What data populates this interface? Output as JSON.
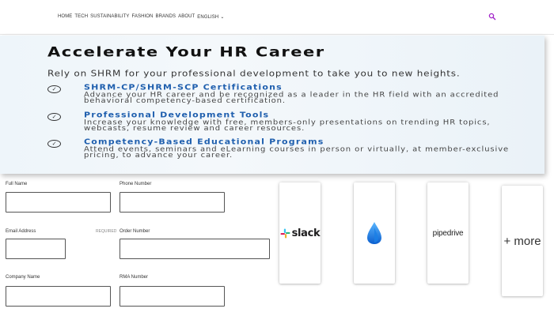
{
  "nav": {
    "items": [
      "HOME",
      "TECH",
      "SUSTAINABILITY",
      "FASHION",
      "BRANDS",
      "ABOUT",
      "ENGLISH"
    ],
    "language_caret": "⌄",
    "search_icon": "search-icon",
    "accent_color": "#a020c8"
  },
  "banner": {
    "title": "Accelerate Your HR Career",
    "intro": "Rely on SHRM for your professional development to take you to new heights.",
    "features": [
      {
        "title": "SHRM-CP/SHRM-SCP Certifications",
        "description": "Advance your HR career and be recognized as a leader in the HR field with an accredited behavioral competency-based certification."
      },
      {
        "title": "Professional Development Tools",
        "description": "Increase your knowledge with free, members-only presentations on trending HR topics, webcasts, resume review and career resources."
      },
      {
        "title": "Competency-Based Educational Programs",
        "description": "Attend events, seminars and eLearning courses in person or virtually, at member-exclusive pricing, to advance your career."
      }
    ],
    "title_color": "#111111",
    "feature_color": "#1f5fae"
  },
  "form": {
    "full_name_label": "Full Name",
    "phone_label": "Phone Number",
    "email_label": "Email Address",
    "email_required": "REQUIRED",
    "order_label": "Order Number",
    "company_label": "Company Name",
    "rma_label": "RMA Number"
  },
  "integrations": {
    "slack": "slack",
    "pipedrive": "pipedrive",
    "more": "+ more"
  }
}
